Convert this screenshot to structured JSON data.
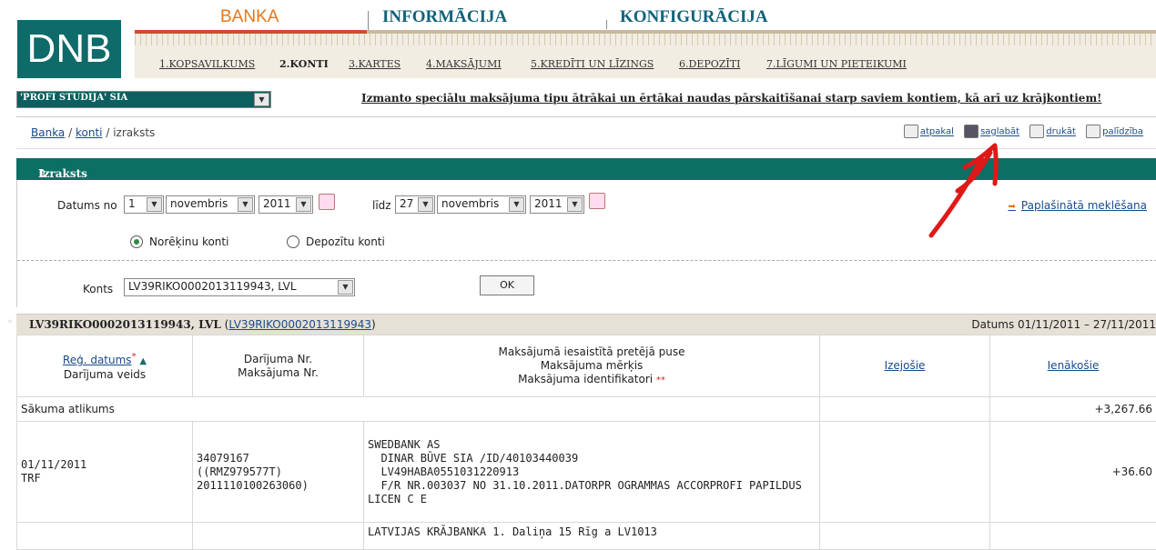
{
  "logo": "DNB",
  "top_nav": [
    "BANKA",
    "INFORMĀCIJA",
    "KONFIGURĀCIJA"
  ],
  "sub_nav": [
    "1.KOPSAVILKUMS",
    "2.KONTI",
    "3.KARTES",
    "4.MAKSĀJUMI",
    "5.KREDĪTI UN LĪZINGS",
    "6.DEPOZĪTI",
    "7.LĪGUMI UN PIETEIKUMI"
  ],
  "company": "'PROFI STUDIJA' SIA",
  "promo": "Izmanto speciālu maksājuma tipu ātrākai un ērtākai naudas pārskaitīšanai starp saviem kontiem, kā arī uz krājkontiem!",
  "breadcrumb": {
    "banka": "Banka",
    "konti": "konti",
    "current": "izraksts",
    "sep": "/"
  },
  "tools": {
    "back": "atpakal",
    "save": "saglabāt",
    "print": "drukāt",
    "help": "palīdzība"
  },
  "panel_title": "Izraksts",
  "form": {
    "date_from_label": "Datums no",
    "from_day": "1",
    "from_month": "novembris",
    "from_year": "2011",
    "to_label": "līdz",
    "to_day": "27",
    "to_month": "novembris",
    "to_year": "2011",
    "advanced_search": "Paplašinātā meklēšana",
    "radio_settlement": "Norēķinu konti",
    "radio_deposit": "Depozītu konti",
    "account_label": "Konts",
    "account_value": "LV39RIKO0002013119943, LVL",
    "ok": "OK"
  },
  "account_bar": {
    "account": "LV39RIKO0002013119943, LVL",
    "open_paren": "(",
    "link": "LV39RIKO0002013119943",
    "close_paren": ")",
    "period": "Datums 01/11/2011 – 27/11/2011"
  },
  "table": {
    "col1_link": "Reģ. datums",
    "col1_sub": "Darījuma veids",
    "col2_a": "Darījuma Nr.",
    "col2_b": "Maksājuma Nr.",
    "col3_a": "Maksājumā iesaistītā pretējā puse",
    "col3_b": "Maksājuma mērķis",
    "col3_c": "Maksājuma identifikatori",
    "col4": "Izejošie",
    "col5": "Ienākošie",
    "opening_label": "Sākuma atlikums",
    "opening_value": "+3,267.66",
    "row1": {
      "date": "01/11/2011",
      "type": "TRF",
      "nr1": "34079167",
      "nr2": "((RMZ979577T)",
      "nr3": "2011110100263060)",
      "cp1": "SWEDBANK AS",
      "cp2": "  DINAR BŪVE SIA /ID/40103440039",
      "cp3": "  LV49HABA0551031220913",
      "cp4": "  F/R NR.003037 NO 31.10.2011.DATORPR OGRAMMAS ACCORPROFI PAPILDUS",
      "cp5": "LICEN C E",
      "incoming": "+36.60"
    },
    "row2_cp1": "LATVIJAS KRĀJBANKA 1. Daliņa 15 Rīg a LV1013"
  },
  "annotation_color": "#e01818"
}
